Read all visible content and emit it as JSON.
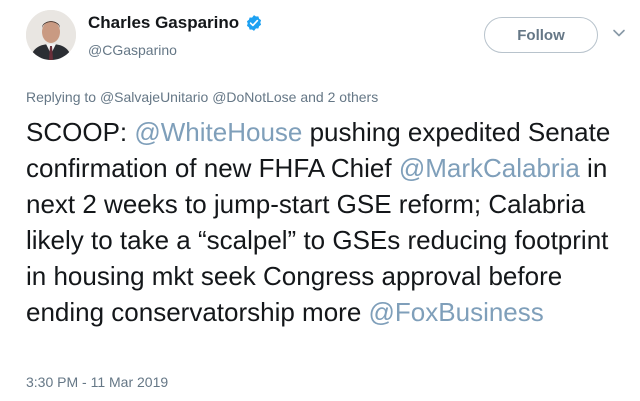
{
  "author": {
    "name": "Charles Gasparino",
    "handle": "@CGasparino"
  },
  "follow_button": {
    "label": "Follow"
  },
  "reply_context": {
    "prefix": "Replying to",
    "users": [
      "@SalvajeUnitario",
      "@DoNotLose"
    ],
    "suffix": "and 2 others"
  },
  "tweet": {
    "segments": [
      "SCOOP: ",
      "@WhiteHouse",
      " pushing expedited Senate confirmation of new FHFA Chief ",
      "@MarkCalabria",
      " in next 2 weeks to jump-start GSE reform; Calabria likely to take a “scalpel” to GSEs reducing footprint in housing mkt seek Congress approval before ending conservatorship more ",
      "@FoxBusiness"
    ]
  },
  "timestamp": "3:30 PM - 11 Mar 2019",
  "colors": {
    "verified": "#1da1f2",
    "mention": "#7f9fba",
    "secondary_text": "#657786"
  },
  "icons": [
    "verified-badge-icon",
    "chevron-down-icon"
  ]
}
